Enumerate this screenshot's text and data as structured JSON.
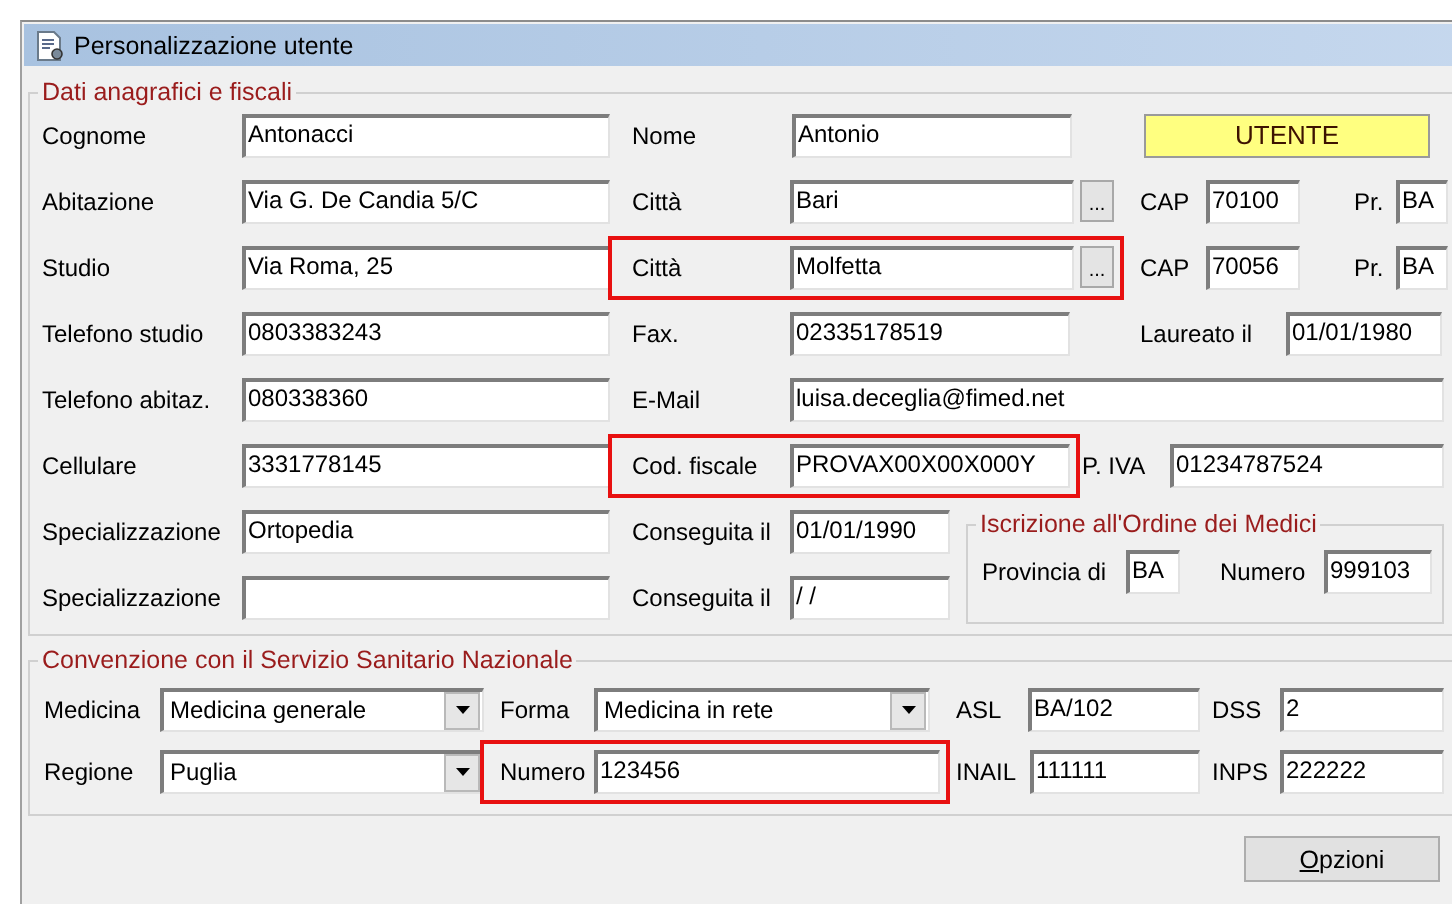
{
  "window": {
    "title": "Personalizzazione utente"
  },
  "personal": {
    "legend": "Dati anagrafici e fiscali",
    "badge": "UTENTE",
    "rows": [
      {
        "fields": [
          {
            "label": "Cognome",
            "value": "Antonacci",
            "highlighted": false
          },
          {
            "label": "Nome",
            "value": "Antonio",
            "highlighted": false
          }
        ]
      },
      {
        "fields": [
          {
            "label": "Abitazione",
            "value": "Via G. De Candia 5/C",
            "highlighted": false
          },
          {
            "label": "Città",
            "value": "Bari",
            "browse": "...",
            "highlighted": false
          },
          {
            "label": "CAP",
            "value": "70100",
            "highlighted": false
          },
          {
            "label": "Pr.",
            "value": "BA",
            "highlighted": false
          }
        ]
      },
      {
        "fields": [
          {
            "label": "Studio",
            "value": "Via Roma, 25",
            "highlighted": false
          },
          {
            "label": "Città",
            "value": "Molfetta",
            "browse": "...",
            "highlighted": true
          },
          {
            "label": "CAP",
            "value": "70056",
            "highlighted": false
          },
          {
            "label": "Pr.",
            "value": "BA",
            "highlighted": false
          }
        ]
      },
      {
        "fields": [
          {
            "label": "Telefono studio",
            "value": "0803383243",
            "highlighted": false
          },
          {
            "label": "Fax.",
            "value": "02335178519",
            "highlighted": false
          },
          {
            "label": "Laureato il",
            "value": "01/01/1980",
            "highlighted": false
          }
        ]
      },
      {
        "fields": [
          {
            "label": "Telefono abitaz.",
            "value": "080338360",
            "highlighted": false
          },
          {
            "label": "E-Mail",
            "value": "luisa.deceglia@fimed.net",
            "highlighted": false
          }
        ]
      },
      {
        "fields": [
          {
            "label": "Cellulare",
            "value": "3331778145",
            "highlighted": false
          },
          {
            "label": "Cod. fiscale",
            "value": "PROVAX00X00X000Y",
            "highlighted": true
          },
          {
            "label": "P. IVA",
            "value": "01234787524",
            "highlighted": false
          }
        ]
      },
      {
        "fields": [
          {
            "label": "Specializzazione",
            "value": "Ortopedia",
            "highlighted": false
          },
          {
            "label": "Conseguita il",
            "value": "01/01/1990",
            "highlighted": false
          }
        ]
      },
      {
        "fields": [
          {
            "label": "Specializzazione",
            "highlighted": false
          },
          {
            "label": "Conseguita il",
            "value": " / /",
            "highlighted": false
          }
        ]
      }
    ]
  },
  "registration": {
    "legend": "Iscrizione all'Ordine dei Medici",
    "fields": [
      {
        "label": "Provincia di",
        "value": "BA",
        "highlighted": false
      },
      {
        "label": "Numero",
        "value": "999103",
        "highlighted": false
      }
    ]
  },
  "convention": {
    "legend": "Convenzione con il Servizio Sanitario Nazionale",
    "rows": [
      {
        "fields": [
          {
            "kind": "dropdown",
            "label": "Medicina",
            "value": "Medicina generale",
            "highlighted": false
          },
          {
            "kind": "dropdown",
            "label": "Forma",
            "value": "Medicina in rete",
            "highlighted": false
          },
          {
            "kind": "text",
            "label": "ASL",
            "value": "BA/102",
            "highlighted": false
          },
          {
            "kind": "text",
            "label": "DSS",
            "value": "2",
            "highlighted": false
          }
        ]
      },
      {
        "fields": [
          {
            "kind": "dropdown",
            "label": "Regione",
            "value": "Puglia",
            "highlighted": false
          },
          {
            "kind": "text",
            "label": "Numero",
            "value": "123456",
            "highlighted": true
          },
          {
            "kind": "text",
            "label": "INAIL",
            "value": "111111",
            "highlighted": false
          },
          {
            "kind": "text",
            "label": "INPS",
            "value": "222222",
            "highlighted": false
          }
        ]
      }
    ]
  },
  "buttons": [
    "Opzioni"
  ]
}
